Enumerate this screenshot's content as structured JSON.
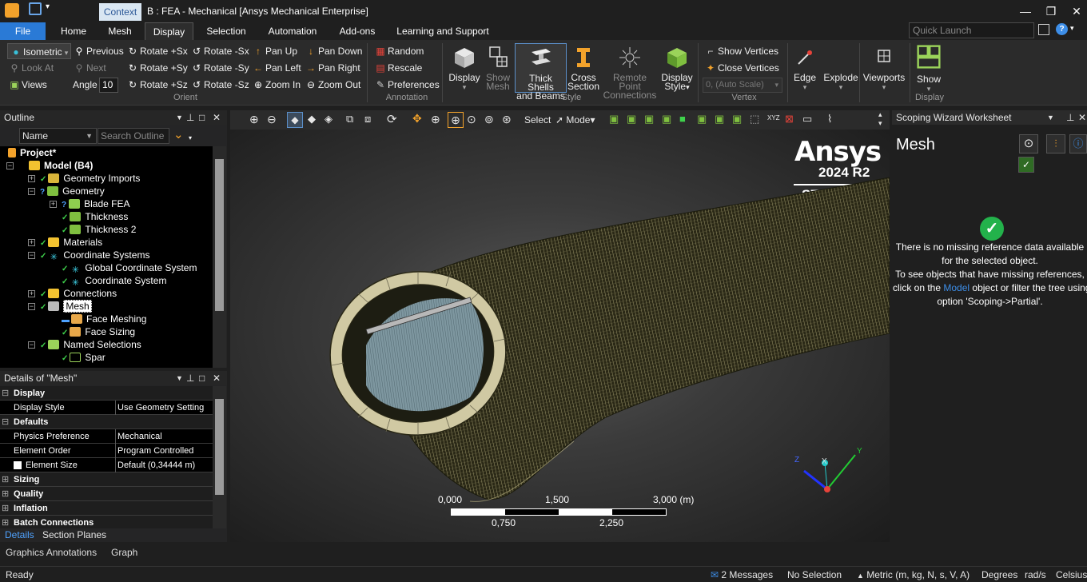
{
  "window": {
    "context_tab": "Context",
    "title": "B : FEA - Mechanical [Ansys Mechanical Enterprise]"
  },
  "menu": {
    "tabs": [
      "File",
      "Home",
      "Mesh",
      "Display",
      "Selection",
      "Automation",
      "Add-ons",
      "Learning and Support"
    ],
    "active": "Display",
    "quick_launch_placeholder": "Quick Launch"
  },
  "ribbon": {
    "orient": {
      "isometric": "Isometric",
      "look_at": "Look At",
      "views": "Views",
      "previous": "Previous",
      "next": "Next",
      "angle_label": "Angle",
      "angle_value": "10",
      "rotate_px": "Rotate +Sx",
      "rotate_mx": "Rotate -Sx",
      "rotate_py": "Rotate +Sy",
      "rotate_my": "Rotate -Sy",
      "rotate_pz": "Rotate +Sz",
      "rotate_mz": "Rotate -Sz",
      "pan_up": "Pan Up",
      "pan_down": "Pan Down",
      "pan_left": "Pan Left",
      "pan_right": "Pan Right",
      "zoom_in": "Zoom In",
      "zoom_out": "Zoom Out",
      "group": "Orient"
    },
    "annotation": {
      "random": "Random",
      "rescale": "Rescale",
      "preferences": "Preferences",
      "group": "Annotation"
    },
    "style": {
      "display": "Display",
      "show_mesh_1": "Show",
      "show_mesh_2": "Mesh",
      "thick_1": "Thick Shells",
      "thick_2": "and Beams",
      "cross_1": "Cross",
      "cross_2": "Section",
      "remote_1": "Remote Point",
      "remote_2": "Connections",
      "dstyle_1": "Display",
      "dstyle_2": "Style",
      "group": "Style"
    },
    "vertex": {
      "show": "Show Vertices",
      "close": "Close Vertices",
      "scale": "0, (Auto Scale)",
      "group": "Vertex"
    },
    "edge": "Edge",
    "explode": "Explode",
    "viewports": "Viewports",
    "show": "Show",
    "display_group": "Display"
  },
  "outline": {
    "title": "Outline",
    "name_filter": "Name",
    "search_placeholder": "Search Outline",
    "tree": [
      {
        "label": "Project*",
        "bold": true
      },
      {
        "label": "Model (B4)",
        "bold": true
      },
      {
        "label": "Geometry Imports"
      },
      {
        "label": "Geometry"
      },
      {
        "label": "Blade FEA"
      },
      {
        "label": "Thickness"
      },
      {
        "label": "Thickness 2"
      },
      {
        "label": "Materials"
      },
      {
        "label": "Coordinate Systems"
      },
      {
        "label": "Global Coordinate System"
      },
      {
        "label": "Coordinate System"
      },
      {
        "label": "Connections"
      },
      {
        "label": "Mesh",
        "selected": true
      },
      {
        "label": "Face Meshing"
      },
      {
        "label": "Face Sizing"
      },
      {
        "label": "Named Selections"
      },
      {
        "label": "Spar"
      }
    ]
  },
  "details": {
    "title": "Details of \"Mesh\"",
    "rows": [
      {
        "section": "Display"
      },
      {
        "key": "Display Style",
        "value": "Use Geometry Setting"
      },
      {
        "section": "Defaults"
      },
      {
        "key": "Physics Preference",
        "value": "Mechanical"
      },
      {
        "key": "Element Order",
        "value": "Program Controlled"
      },
      {
        "key": "Element Size",
        "value": "Default (0,34444 m)"
      },
      {
        "section": "Sizing"
      },
      {
        "section": "Quality"
      },
      {
        "section": "Inflation"
      },
      {
        "section": "Batch Connections"
      }
    ],
    "tabs": [
      "Details",
      "Section Planes"
    ]
  },
  "graphics": {
    "select_label": "Select",
    "mode_label": "Mode",
    "logo_name": "Ansys",
    "logo_version": "2024 R2",
    "logo_edition": "STUDENT",
    "scale_top": [
      "0,000",
      "1,500",
      "3,000 (m)"
    ],
    "scale_bottom": [
      "0,750",
      "2,250"
    ],
    "triad": {
      "x": "X",
      "y": "Y",
      "z": "Z"
    }
  },
  "scoping": {
    "title": "Scoping Wizard Worksheet",
    "heading": "Mesh",
    "lines": [
      "There is no missing reference data available",
      "for the selected object.",
      "To see objects that have missing references,"
    ],
    "line4_pre": "click on the ",
    "line4_link": "Model",
    "line4_post": " object or filter the tree using",
    "line5": "option 'Scoping->Partial'."
  },
  "bottom_tabs": [
    "Graphics Annotations",
    "Graph"
  ],
  "status": {
    "ready": "Ready",
    "messages": "2 Messages",
    "selection": "No Selection",
    "units": "Metric (m, kg, N, s, V, A)",
    "angle": "Degrees",
    "speed": "rad/s",
    "temp": "Celsius"
  },
  "colors": {
    "accent": "#2a7ad6",
    "check": "#23b24b",
    "mesh": "#c8c08a",
    "link": "#3d8ee8"
  }
}
